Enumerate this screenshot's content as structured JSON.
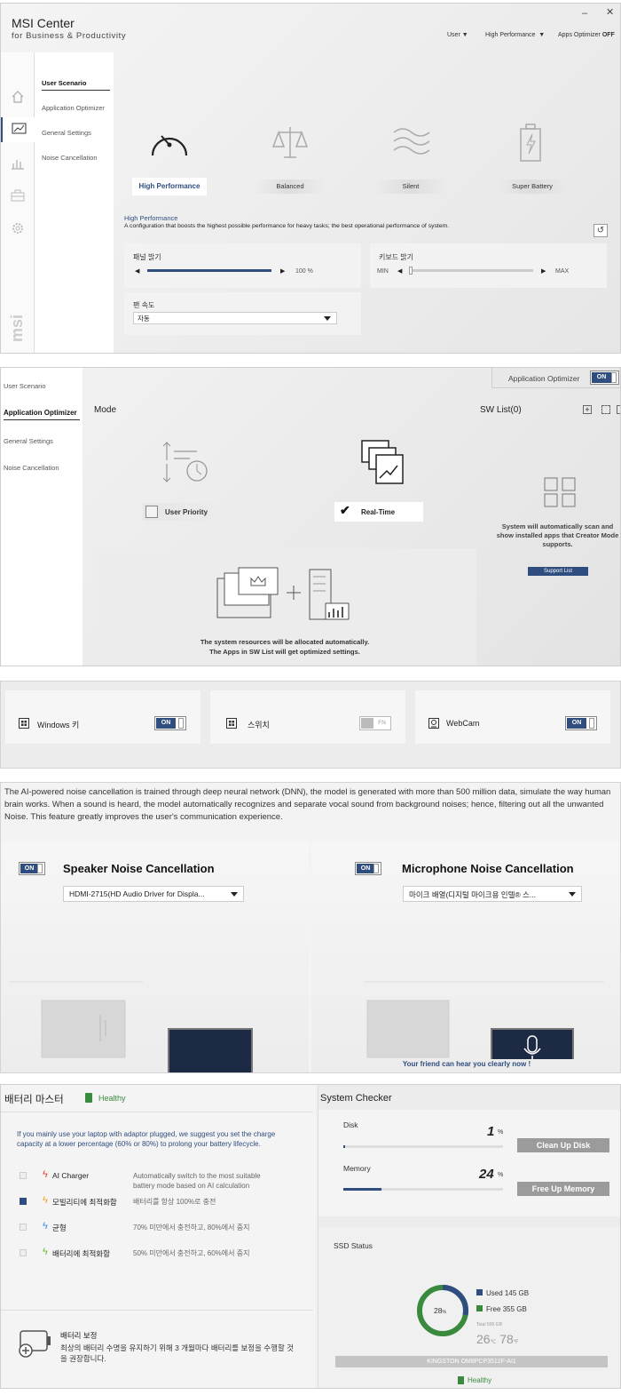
{
  "window": {
    "brand_title": "MSI Center",
    "brand_subtitle": "for Business & Productivity",
    "top_user": "User",
    "top_mode": "High Performance",
    "top_optimizer_label": "Apps Optimizer",
    "top_optimizer_state": "OFF",
    "logo_text": "msi"
  },
  "user_scenario_panel": {
    "nav": [
      "User Scenario",
      "Application Optimizer",
      "General Settings",
      "Noise Cancellation"
    ],
    "modes": [
      "High Performance",
      "Balanced",
      "Silent",
      "Super Battery"
    ],
    "selected_mode_title": "High Performance",
    "selected_mode_desc": "A configuration that boosts the highest possible performance for heavy tasks; the best operational performance of system.",
    "panel_brightness_label": "패널 밝기",
    "panel_brightness_value": "100 %",
    "panel_brightness_fraction": 1.0,
    "keyboard_brightness_label": "키보드 밝기",
    "keyboard_min": "MIN",
    "keyboard_max": "MAX",
    "fan_speed_label": "팬 속도",
    "fan_speed_value": "자동"
  },
  "app_optimizer_panel": {
    "nav": [
      "User Scenario",
      "Application Optimizer",
      "General Settings",
      "Noise Cancellation"
    ],
    "header_label": "Application Optimizer",
    "header_toggle": "ON",
    "mode_title": "Mode",
    "sw_list_title": "SW List(0)",
    "option_user_priority": "User Priority",
    "option_real_time": "Real-Time",
    "info_line1": "The system resources will be allocated automatically.",
    "info_line2": "The Apps in SW List will get optimized settings.",
    "sw_info": "System will automatically scan and show installed apps that Creator Mode supports.",
    "support_list_button": "Support List"
  },
  "general_settings_panel": {
    "items": [
      {
        "label": "Windows 키",
        "state": "ON"
      },
      {
        "label": "스위치",
        "state": "FN"
      },
      {
        "label": "WebCam",
        "state": "ON"
      }
    ]
  },
  "noise_panel": {
    "description": "The AI-powered noise cancellation is trained through deep neural network (DNN), the model is generated with more than 500 million data, simulate the way human brain works. When a sound is heard, the model automatically recognizes and separate vocal sound from background noises; hence, filtering out all the unwanted Noise. This feature greatly improves the user's communication experience.",
    "speaker_title": "Speaker Noise Cancellation",
    "speaker_toggle": "ON",
    "speaker_device": "HDMI-2715(HD Audio Driver for Displa...",
    "mic_title": "Microphone Noise Cancellation",
    "mic_toggle": "ON",
    "mic_device": "마이크 배열(디지털 마이크용 인텔® 스...",
    "mic_caption": "Your friend can hear you clearly now !"
  },
  "battery_panel": {
    "title": "배터리 마스터",
    "status": "Healthy",
    "advice": "If you mainly use your laptop with adaptor plugged, we suggest you set the charge capacity at a lower percentage (60% or 80%) to prolong your battery lifecycle.",
    "options": [
      {
        "name": "AI Charger",
        "desc": "Automatically switch to the most suitable battery mode based on AI calculation",
        "checked": false,
        "color": "#e03c31"
      },
      {
        "name": "모빌리티에 최적화함",
        "desc": "배터리를 항상 100%로 충전",
        "checked": true,
        "color": "#f2a51a"
      },
      {
        "name": "균형",
        "desc": "70% 미만에서 충전하고, 80%에서 중지",
        "checked": false,
        "color": "#3d8ae0"
      },
      {
        "name": "배터리에 최적화함",
        "desc": "50% 미만에서 충전하고, 60%에서 중지",
        "checked": false,
        "color": "#6ab83a"
      }
    ],
    "calibration_title": "배터리 보정",
    "calibration_desc": "최상의 배터리 수명을 유지하기 위해 3 개월마다 배터리를 보정을 수행할 것을 권장합니다."
  },
  "system_checker": {
    "title": "System Checker",
    "disk_label": "Disk",
    "disk_value": "1",
    "disk_unit": "%",
    "disk_fraction": 0.01,
    "disk_button": "Clean Up Disk",
    "memory_label": "Memory",
    "memory_value": "24",
    "memory_unit": "%",
    "memory_fraction": 0.24,
    "memory_button": "Free Up Memory",
    "ssd_title": "SSD Status",
    "ssd_percent": "28",
    "ssd_percent_unit": "%",
    "ssd_used_fraction": 0.28,
    "used_label": "Used",
    "used_value": "145 GB",
    "free_label": "Free",
    "free_value": "355 GB",
    "total_label": "Total 500 GB",
    "temp_c": "26",
    "temp_c_unit": "℃",
    "temp_f": "78",
    "temp_f_unit": "℉",
    "ssd_model": "KINGSTON OM8PCP3512F-AI1",
    "ssd_health": "Healthy",
    "colors": {
      "used": "#2f4d7e",
      "free": "#3a8a3e",
      "accent": "#2f4d7e"
    }
  }
}
